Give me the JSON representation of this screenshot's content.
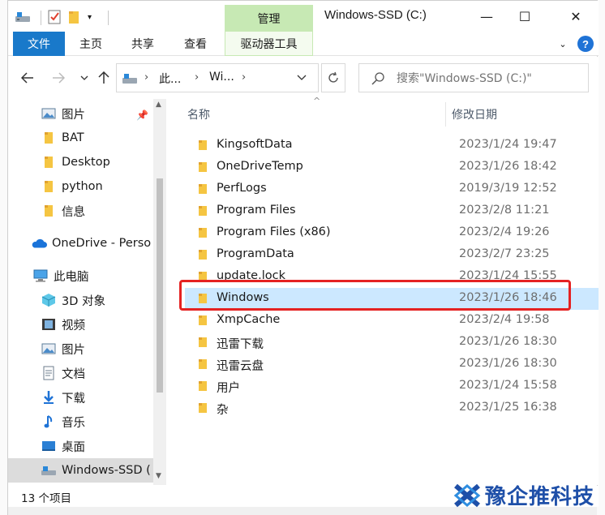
{
  "window": {
    "title": "Windows-SSD (C:)",
    "manage_tab": "管理",
    "controls": {
      "minimize": "—",
      "maximize": "☐",
      "close": "✕"
    }
  },
  "ribbon": {
    "tabs": [
      "文件",
      "主页",
      "共享",
      "查看",
      "驱动器工具"
    ],
    "expand": "⌄",
    "help": "?"
  },
  "address": {
    "crumbs": [
      "此...",
      "Wi..."
    ],
    "separator": "›",
    "dropdown": "⌄"
  },
  "search": {
    "placeholder": "搜索\"Windows-SSD (C:)\""
  },
  "navpane": {
    "items": [
      {
        "label": "图片",
        "icon": "pictures-icon",
        "pinned": true
      },
      {
        "label": "BAT",
        "icon": "folder-icon"
      },
      {
        "label": "Desktop",
        "icon": "folder-icon"
      },
      {
        "label": "python",
        "icon": "folder-icon"
      },
      {
        "label": "信息",
        "icon": "folder-icon"
      },
      {
        "label": "OneDrive - Perso",
        "icon": "onedrive-icon"
      },
      {
        "label": "此电脑",
        "icon": "this-pc-icon"
      },
      {
        "label": "3D 对象",
        "icon": "3d-objects-icon"
      },
      {
        "label": "视频",
        "icon": "videos-icon"
      },
      {
        "label": "图片",
        "icon": "pictures-icon"
      },
      {
        "label": "文档",
        "icon": "documents-icon"
      },
      {
        "label": "下载",
        "icon": "downloads-icon"
      },
      {
        "label": "音乐",
        "icon": "music-icon"
      },
      {
        "label": "桌面",
        "icon": "desktop-icon"
      },
      {
        "label": "Windows-SSD (",
        "icon": "drive-icon"
      }
    ]
  },
  "filelist": {
    "columns": {
      "name": "名称",
      "date": "修改日期"
    },
    "rows": [
      {
        "name": "KingsoftData",
        "date": "2023/1/24 19:47"
      },
      {
        "name": "OneDriveTemp",
        "date": "2023/1/26 18:42"
      },
      {
        "name": "PerfLogs",
        "date": "2019/3/19 12:52"
      },
      {
        "name": "Program Files",
        "date": "2023/2/8 11:21"
      },
      {
        "name": "Program Files (x86)",
        "date": "2023/2/4 19:26"
      },
      {
        "name": "ProgramData",
        "date": "2023/2/7 23:25"
      },
      {
        "name": "update.lock",
        "date": "2023/1/24 15:55"
      },
      {
        "name": "Windows",
        "date": "2023/1/26 18:46"
      },
      {
        "name": "XmpCache",
        "date": "2023/2/4 19:58"
      },
      {
        "name": "迅雷下载",
        "date": "2023/1/26 18:30"
      },
      {
        "name": "迅雷云盘",
        "date": "2023/1/26 18:30"
      },
      {
        "name": "用户",
        "date": "2023/1/24 15:58"
      },
      {
        "name": "杂",
        "date": "2023/1/25 16:38"
      }
    ]
  },
  "status": {
    "count": "13 个项目"
  },
  "watermark": {
    "text": "豫企推科技"
  },
  "colors": {
    "accent": "#1979ca",
    "manage": "#c7e9b4",
    "selection": "#cce8ff",
    "highlight": "#e52222"
  }
}
